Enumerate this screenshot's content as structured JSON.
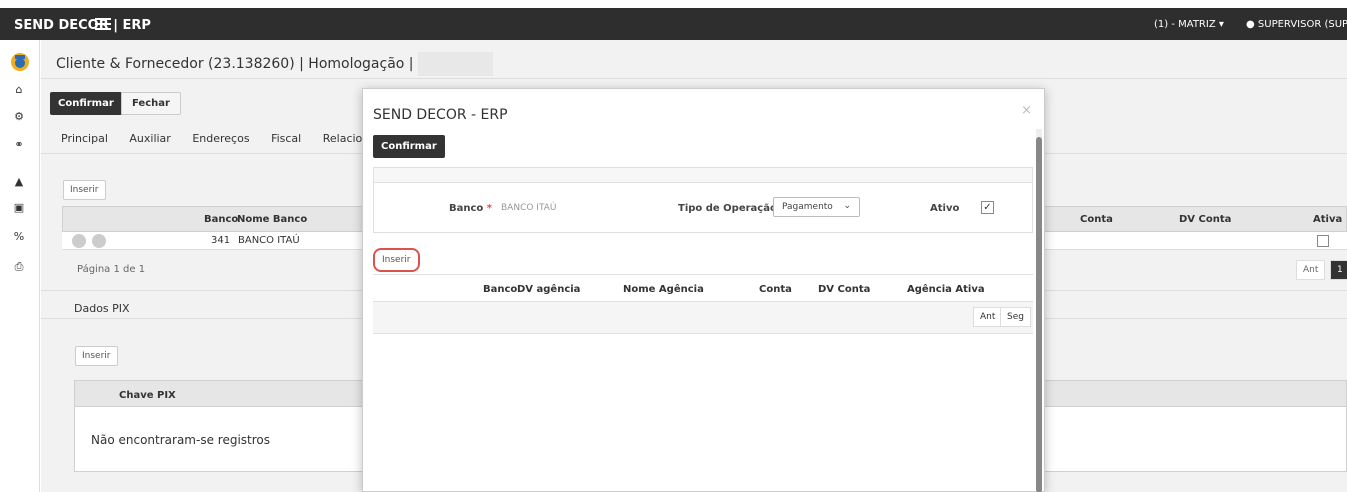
{
  "topbar": {
    "brand": "SEND DECOR | ERP",
    "company_selector": "(1) - MATRIZ ▾",
    "user": "SUPERVISOR (SUPE"
  },
  "page": {
    "title": "Cliente & Fornecedor (23.138260) | Homologação |",
    "confirm_label": "Confirmar",
    "close_label": "Fechar",
    "tabs": [
      "Principal",
      "Auxiliar",
      "Endereços",
      "Fiscal",
      "Relacionan"
    ],
    "insert_label": "Inserir",
    "bank_grid": {
      "headers": [
        "Banco",
        "Nome Banco",
        "Conta",
        "DV Conta",
        "Ativa"
      ],
      "rows": [
        {
          "banco": "341",
          "nome": "BANCO ITAÚ",
          "ativa": false
        }
      ]
    },
    "pager": {
      "text": "Página 1 de 1",
      "prev": "Ant",
      "page": "1"
    },
    "pix": {
      "title": "Dados PIX",
      "insert_label": "Inserir",
      "header": "Chave PIX",
      "empty": "Não encontraram-se registros"
    }
  },
  "modal": {
    "title": "SEND DECOR - ERP",
    "close": "×",
    "confirm_label": "Confirmar",
    "form": {
      "bank_label": "Banco",
      "bank_value": "BANCO ITAÚ",
      "op_label": "Tipo de Operação",
      "op_value": "Pagamento",
      "active_label": "Ativo",
      "active_checked": true
    },
    "insert_label": "Inserir",
    "grid_headers": [
      "Banco",
      "DV agência",
      "Nome Agência",
      "Conta",
      "DV Conta",
      "Agência Ativa"
    ],
    "pager": {
      "prev": "Ant",
      "next": "Seg"
    }
  },
  "colors": {
    "dark": "#333333",
    "required": "#d9534f",
    "accent_highlight": "#d9534f"
  }
}
